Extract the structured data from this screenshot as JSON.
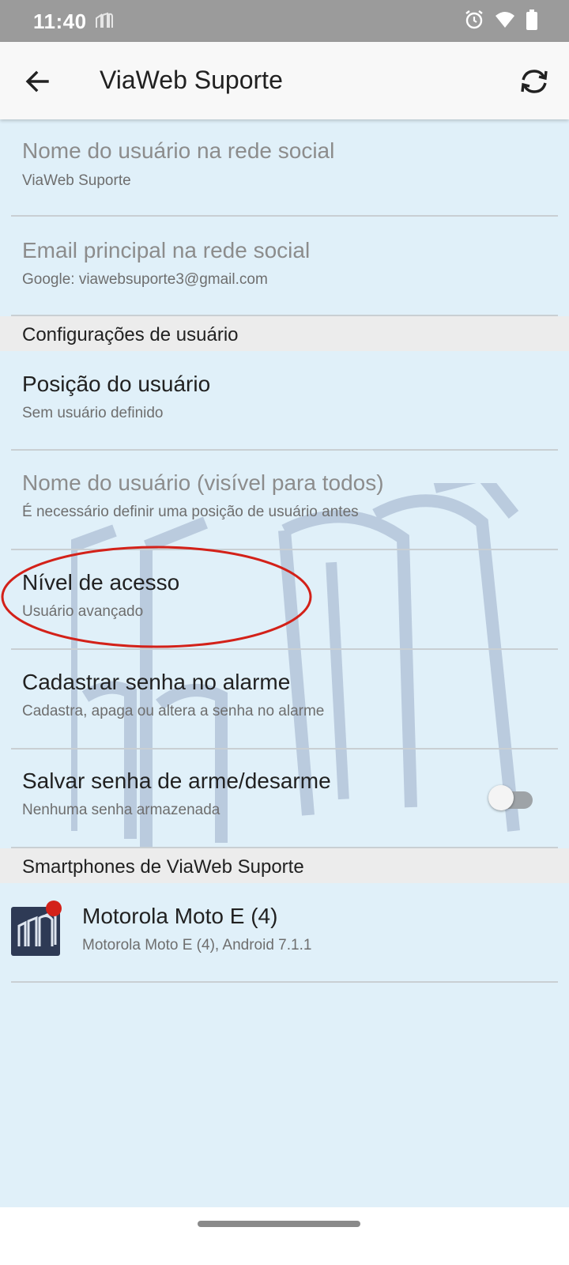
{
  "status_bar": {
    "time": "11:40",
    "icons": [
      "app-notification-icon",
      "alarm-icon",
      "wifi-icon",
      "battery-icon"
    ]
  },
  "app_bar": {
    "title": "ViaWeb Suporte",
    "back_icon": "arrow-back-icon",
    "sync_icon": "sync-icon"
  },
  "account": {
    "items": [
      {
        "title": "Nome do usuário na rede social",
        "subtitle": "ViaWeb Suporte",
        "enabled": false
      },
      {
        "title": "Email principal na rede social",
        "subtitle": "Google: viawebsuporte3@gmail.com",
        "enabled": false
      }
    ]
  },
  "user_settings": {
    "header": "Configurações de usuário",
    "items": [
      {
        "title": "Posição do usuário",
        "subtitle": "Sem usuário definido",
        "enabled": true
      },
      {
        "title": "Nome do usuário (visível para todos)",
        "subtitle": "É necessário definir uma posição de usuário antes",
        "enabled": false
      },
      {
        "title": "Nível de acesso",
        "subtitle": "Usuário avançado",
        "enabled": true
      },
      {
        "title": "Cadastrar senha no alarme",
        "subtitle": "Cadastra, apaga ou altera a senha no alarme",
        "enabled": true
      },
      {
        "title": "Salvar senha de arme/desarme",
        "subtitle": "Nenhuma senha armazenada",
        "enabled": true,
        "toggle_on": false
      }
    ]
  },
  "smartphones": {
    "header": "Smartphones de ViaWeb Suporte",
    "devices": [
      {
        "name": "Motorola Moto E (4)",
        "detail": "Motorola Moto E (4), Android 7.1.1"
      }
    ]
  },
  "colors": {
    "background": "#e0f0f9",
    "app_bar": "#f8f8f8",
    "status_bar": "#9b9b9b",
    "section_header": "#ececec",
    "annotation": "#d32119"
  }
}
